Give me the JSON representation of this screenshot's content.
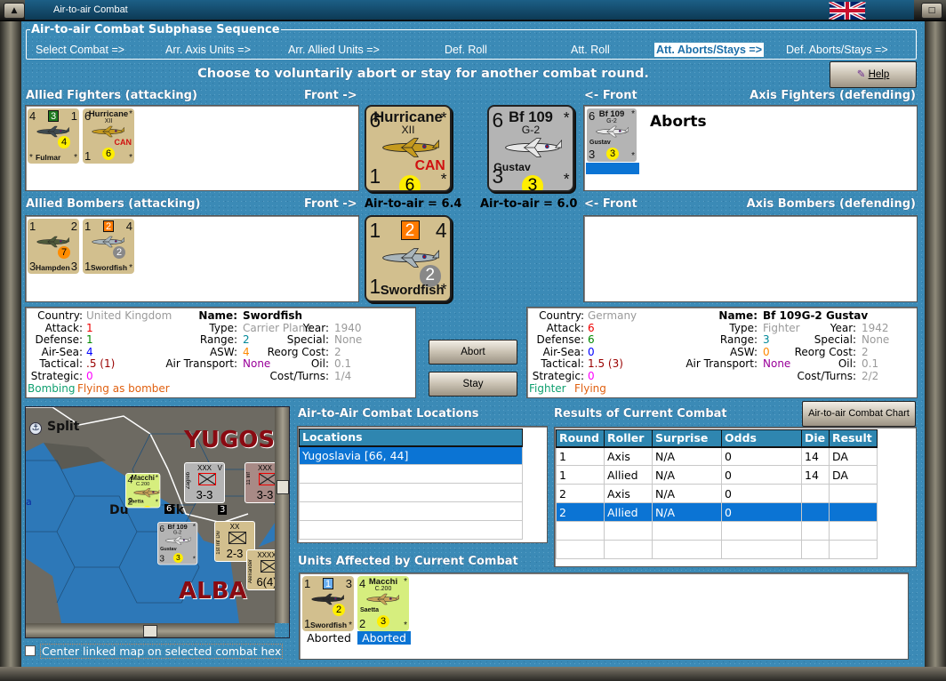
{
  "window": {
    "title": "Air-to-air Combat"
  },
  "sequence": {
    "title": "Air-to-air Combat Subphase Sequence",
    "phases": [
      "Select Combat =>",
      "Arr. Axis Units =>",
      "Arr. Allied Units =>",
      "Def. Roll",
      "Att. Roll",
      "Att. Aborts/Stays =>",
      "Def. Aborts/Stays =>"
    ],
    "active_index": 5
  },
  "instruction": "Choose to voluntarily abort or stay for another combat round.",
  "help_button": "Help",
  "labels": {
    "allied_fighters": "Allied Fighters (attacking)",
    "front_right": "Front ->",
    "front_left": "<- Front",
    "axis_fighters": "Axis Fighters (defending)",
    "allied_bombers": "Allied Bombers (attacking)",
    "axis_bombers": "Axis Bombers (defending)",
    "allied_a2a": "Air-to-air = 6.4",
    "axis_a2a": "Air-to-air = 6.0",
    "axis_fighter_status": "Aborts"
  },
  "counters": {
    "allied_fighters": [
      {
        "tl": "4",
        "tr": "1",
        "bl": "*",
        "br": "*",
        "badge": "3",
        "badge_bg": "#1e7a1e",
        "circle": "4",
        "circle_bg": "#ffee00",
        "bottom_name": "Fulmar",
        "plane": "#3e4a4f",
        "bg": "#d2bf8e"
      },
      {
        "tl": "6",
        "tr": "*",
        "bl": "1",
        "br": "*",
        "title": "Hurricane",
        "sub": "XII",
        "nation": "CAN",
        "circle": "6",
        "circle_bg": "#ffee00",
        "plane": "#c59a1e",
        "bg": "#d2bf8e"
      }
    ],
    "allied_bombers": [
      {
        "tl": "1",
        "tr": "2",
        "bl": "3",
        "br": "3",
        "circle": "7",
        "circle_bg": "#ff8c00",
        "bottom_name": "Hampden",
        "plane": "#4e5a3a",
        "bg": "#d2bf8e"
      },
      {
        "tl": "1",
        "tr": "4",
        "bl": "1",
        "br": "*",
        "badge": "2",
        "badge_bg": "#ff7a00",
        "circle": "2",
        "circle_bg": "#888888",
        "bottom_name": "Swordfish",
        "plane": "#a9b5bb",
        "bg": "#d2bf8e"
      }
    ],
    "axis_fighters": [
      {
        "tl": "6",
        "tr": "*",
        "bl": "3",
        "br": "*",
        "title": "Bf 109",
        "sub": "G-2",
        "nick": "Gustav",
        "circle": "3",
        "circle_bg": "#ffee00",
        "plane": "#e8e8e8",
        "bg": "#b4b4b4"
      }
    ],
    "front_allied_fighter": {
      "tl": "6",
      "tr": "*",
      "bl": "1",
      "br": "*",
      "title": "Hurricane",
      "sub": "XII",
      "nation": "CAN",
      "circle": "6",
      "circle_bg": "#ffee00",
      "plane": "#c59a1e",
      "bg": "#d2bf8e"
    },
    "front_axis_fighter": {
      "tl": "6",
      "tr": "*",
      "bl": "3",
      "br": "*",
      "title": "Bf 109",
      "sub": "G-2",
      "nick": "Gustav",
      "circle": "3",
      "circle_bg": "#ffee00",
      "plane": "#e8e8e8",
      "bg": "#b4b4b4"
    },
    "front_allied_bomber": {
      "tl": "1",
      "tr": "4",
      "bl": "1",
      "br": "*",
      "badge": "2",
      "badge_bg": "#ff7a00",
      "circle": "2",
      "circle_bg": "#888888",
      "bottom_name": "Swordfish",
      "plane": "#a9b5bb",
      "bg": "#d2bf8e"
    },
    "affected": [
      {
        "tl": "1",
        "tr": "3",
        "bl": "1",
        "br": "*",
        "badge": "1",
        "badge_bg": "#6aaef0",
        "circle": "2",
        "circle_bg": "#ffee00",
        "bottom_name": "Swordfish",
        "plane": "#2d2d2d",
        "bg": "#d2bf8e",
        "status": "Aborted"
      },
      {
        "tl": "4",
        "tr": "*",
        "bl": "2",
        "br": "*",
        "title": "Macchi",
        "sub": "C.200",
        "nick": "Saetta",
        "circle": "3",
        "circle_bg": "#ffee00",
        "plane": "#c9a35a",
        "bg": "#d6ee7e",
        "status": "Aborted"
      }
    ]
  },
  "allied_info": {
    "country_label": "Country:",
    "country": "United Kingdom",
    "attack_label": "Attack:",
    "attack": "1",
    "defense_label": "Defense:",
    "defense": "1",
    "airsea_label": "Air-Sea:",
    "airsea": "4",
    "tactical_label": "Tactical:",
    "tactical": ".5 (1)",
    "strategic_label": "Strategic:",
    "strategic": "0",
    "name_label": "Name:",
    "name": "Swordfish",
    "type_label": "Type:",
    "type": "Carrier Plane",
    "range_label": "Range:",
    "range": "2",
    "asw_label": "ASW:",
    "asw": "4",
    "transport_label": "Air Transport:",
    "transport": "None",
    "year_label": "Year:",
    "year": "1940",
    "special_label": "Special:",
    "special": "None",
    "reorg_label": "Reorg Cost:",
    "reorg": "2",
    "oil_label": "Oil:",
    "oil": "0.1",
    "cost_label": "Cost/Turns:",
    "cost": "1/4",
    "role": "Bombing",
    "mode": "Flying as bomber"
  },
  "axis_info": {
    "country_label": "Country:",
    "country": "Germany",
    "attack_label": "Attack:",
    "attack": "6",
    "defense_label": "Defense:",
    "defense": "6",
    "airsea_label": "Air-Sea:",
    "airsea": "0",
    "tactical_label": "Tactical:",
    "tactical": "1.5 (3)",
    "strategic_label": "Strategic:",
    "strategic": "0",
    "name_label": "Name:",
    "name": "Bf 109G-2 Gustav",
    "type_label": "Type:",
    "type": "Fighter",
    "range_label": "Range:",
    "range": "3",
    "asw_label": "ASW:",
    "asw": "0",
    "transport_label": "Air Transport:",
    "transport": "None",
    "year_label": "Year:",
    "year": "1942",
    "special_label": "Special:",
    "special": "None",
    "reorg_label": "Reorg Cost:",
    "reorg": "2",
    "oil_label": "Oil:",
    "oil": "0.1",
    "cost_label": "Cost/Turns:",
    "cost": "2/2",
    "role": "Fighter",
    "mode": "Flying"
  },
  "buttons": {
    "abort": "Abort",
    "stay": "Stay",
    "chart": "Air-to-air Combat Chart"
  },
  "map": {
    "labels": {
      "split": "Split",
      "yugos": "YUGOS",
      "alba": "ALBA",
      "dubrovnik": "Du",
      "dubrovnik_end": "ik",
      "sea": "a"
    },
    "units": [
      {
        "type": "XXX",
        "nat": "V",
        "val": "3-3",
        "name": "Zagreb"
      },
      {
        "type": "XXX",
        "val": "3-3",
        "name": "11 Inf"
      },
      {
        "type": "XX",
        "val": "2-3",
        "name": "1st Inf Div"
      },
      {
        "type": "XXXX",
        "val": "6(4)",
        "name": "Alexander"
      }
    ],
    "markers": [
      "6",
      "3",
      "2"
    ],
    "center_checkbox_label": "Center linked map on selected combat hex",
    "center_checkbox_checked": false
  },
  "locations": {
    "title": "Air-to-Air Combat Locations",
    "header": "Locations",
    "rows": [
      "Yugoslavia [66, 44]"
    ],
    "selected": 0
  },
  "results": {
    "title": "Results of Current Combat",
    "columns": [
      "Round",
      "Roller",
      "Surprise",
      "Odds",
      "Die",
      "Result"
    ],
    "rows": [
      [
        "1",
        "Axis",
        "N/A",
        "0",
        "14",
        "DA"
      ],
      [
        "1",
        "Allied",
        "N/A",
        "0",
        "14",
        "DA"
      ],
      [
        "2",
        "Axis",
        "N/A",
        "0",
        "",
        ""
      ],
      [
        "2",
        "Allied",
        "N/A",
        "0",
        "",
        ""
      ]
    ],
    "selected": 3
  },
  "affected": {
    "title": "Units Affected by Current Combat"
  }
}
